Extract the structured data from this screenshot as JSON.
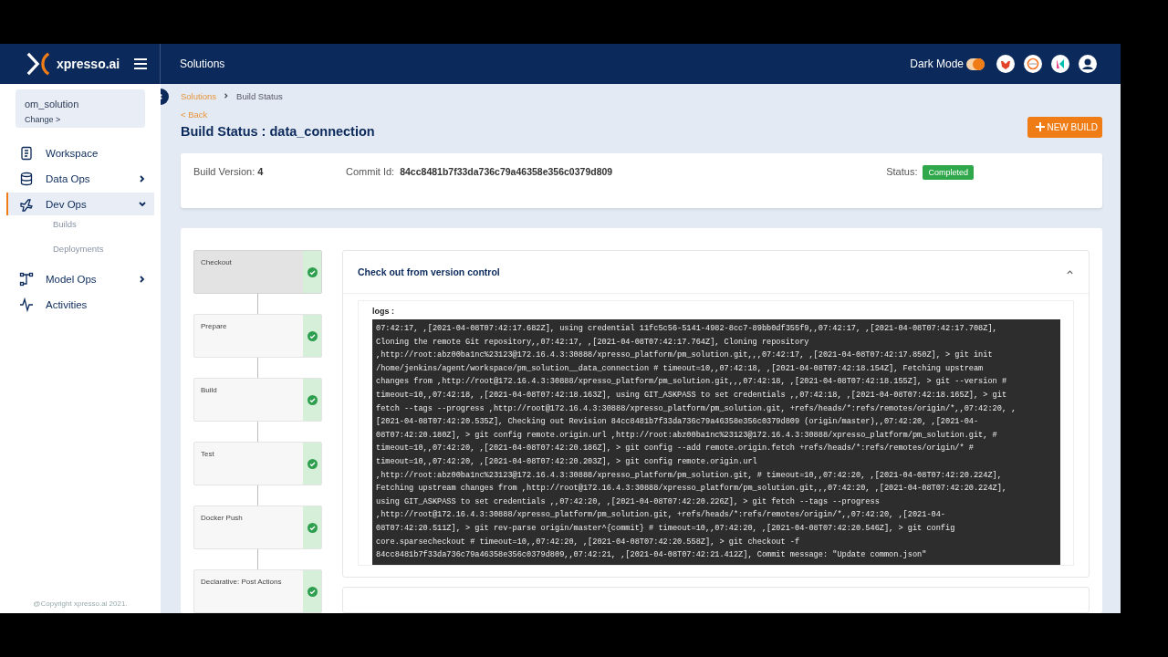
{
  "header": {
    "brand": "xpresso.ai",
    "section": "Solutions",
    "dark_mode": {
      "label": "Dark Mode",
      "on": true
    }
  },
  "sidebar": {
    "solution": "om_solution",
    "change": "Change >",
    "items": [
      {
        "label": "Workspace",
        "selected": false
      },
      {
        "label": "Data Ops",
        "selected": false,
        "expanded": false
      },
      {
        "label": "Dev Ops",
        "selected": true,
        "expanded": true,
        "children": [
          {
            "label": "Builds"
          },
          {
            "label": "Deployments"
          }
        ]
      },
      {
        "label": "Model Ops",
        "selected": false,
        "expanded": false
      },
      {
        "label": "Activities",
        "selected": false
      }
    ],
    "copyright": "@Copyright xpresso.ai 2021."
  },
  "breadcrumb": [
    "Solutions",
    "Build Status"
  ],
  "back": "< Back",
  "title": "Build Status : data_connection",
  "new_build": "NEW BUILD",
  "summary": {
    "version_label": "Build Version:",
    "version": "4",
    "commit_label": "Commit Id:",
    "commit": "84cc8481b7f33da736c79a46358e356c0379d809",
    "status_label": "Status:",
    "status": "Completed"
  },
  "stages": [
    {
      "name": "Checkout",
      "selected": true,
      "passed": true
    },
    {
      "name": "Prepare",
      "selected": false,
      "passed": true
    },
    {
      "name": "Build",
      "selected": false,
      "passed": true
    },
    {
      "name": "Test",
      "selected": false,
      "passed": true
    },
    {
      "name": "Docker Push",
      "selected": false,
      "passed": true
    },
    {
      "name": "Declarative: Post Actions",
      "selected": false,
      "passed": true
    }
  ],
  "stage_panel": {
    "title": "Check out from version control",
    "expanded": true,
    "logs_label": "logs :",
    "logs": [
      "07:42:17, ,[2021-04-08T07:42:17.682Z], using credential 11fc5c56-5141-4982-8cc7-89bb0df355f9,,07:42:17, ,[2021-04-08T07:42:17.708Z],",
      "Cloning the remote Git repository,,07:42:17, ,[2021-04-08T07:42:17.764Z], Cloning repository",
      ",http://root:abz00ba1nc%23123@172.16.4.3:30888/xpresso_platform/pm_solution.git,,,07:42:17, ,[2021-04-08T07:42:17.850Z], > git init",
      "/home/jenkins/agent/workspace/pm_solution__data_connection # timeout=10,,07:42:18, ,[2021-04-08T07:42:18.154Z], Fetching upstream",
      "changes from ,http://root@172.16.4.3:30888/xpresso_platform/pm_solution.git,,,07:42:18, ,[2021-04-08T07:42:18.155Z], > git --version #",
      "timeout=10,,07:42:18, ,[2021-04-08T07:42:18.163Z], using GIT_ASKPASS to set credentials ,,07:42:18, ,[2021-04-08T07:42:18.165Z], > git",
      "fetch --tags --progress ,http://root@172.16.4.3:30888/xpresso_platform/pm_solution.git, +refs/heads/*:refs/remotes/origin/*,,07:42:20, ,",
      "[2021-04-08T07:42:20.535Z], Checking out Revision 84cc8481b7f33da736c79a46358e356c0379d809 (origin/master),,07:42:20, ,[2021-04-",
      "08T07:42:20.180Z], > git config remote.origin.url ,http://root:abz00ba1nc%23123@172.16.4.3:30888/xpresso_platform/pm_solution.git, #",
      "timeout=10,,07:42:20, ,[2021-04-08T07:42:20.186Z], > git config --add remote.origin.fetch +refs/heads/*:refs/remotes/origin/* #",
      "timeout=10,,07:42:20, ,[2021-04-08T07:42:20.203Z], > git config remote.origin.url",
      ",http://root:abz00ba1nc%23123@172.16.4.3:30888/xpresso_platform/pm_solution.git, # timeout=10,,07:42:20, ,[2021-04-08T07:42:20.224Z],",
      "Fetching upstream changes from ,http://root@172.16.4.3:30888/xpresso_platform/pm_solution.git,,,07:42:20, ,[2021-04-08T07:42:20.224Z],",
      "using GIT_ASKPASS to set credentials ,,07:42:20, ,[2021-04-08T07:42:20.226Z], > git fetch --tags --progress",
      ",http://root@172.16.4.3:30888/xpresso_platform/pm_solution.git, +refs/heads/*:refs/remotes/origin/*,,07:42:20, ,[2021-04-",
      "08T07:42:20.511Z], > git rev-parse origin/master^{commit} # timeout=10,,07:42:20, ,[2021-04-08T07:42:20.546Z], > git config",
      "core.sparsecheckout # timeout=10,,07:42:20, ,[2021-04-08T07:42:20.558Z], > git checkout -f",
      "84cc8481b7f33da736c79a46358e356c0379d809,,07:42:21, ,[2021-04-08T07:42:21.412Z], Commit message: \"Update common.json\""
    ]
  }
}
